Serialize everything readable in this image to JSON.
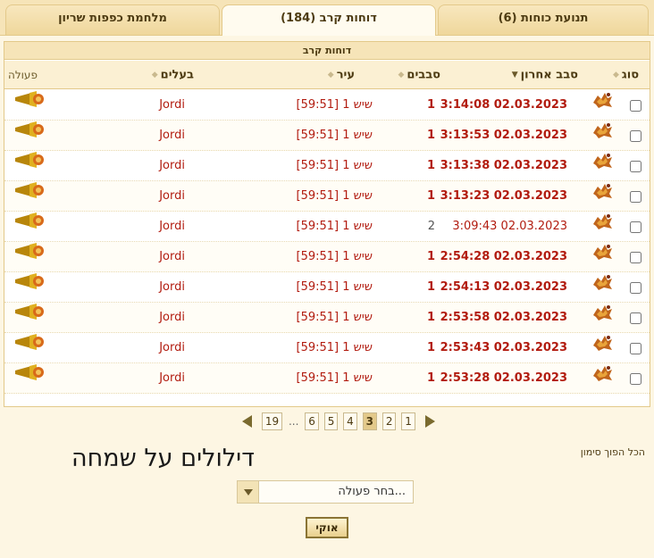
{
  "tabs": [
    {
      "label": "מלחמת כפפות שריון"
    },
    {
      "label": "דוחות קרב (184)"
    },
    {
      "label": "תנועת כוחות (6)"
    }
  ],
  "panel": {
    "title": "דוחות קרב"
  },
  "columns": {
    "type": "סוג",
    "last_round": "סבב אחרון",
    "rounds": "סבבים",
    "city": "עיר",
    "owner": "בעלים",
    "action": "פעולה"
  },
  "rows": [
    {
      "date": "3:14:08 02.03.2023",
      "rounds": "1",
      "city": "שיש 1 [59:51]",
      "owner": "Jordi",
      "unread": true
    },
    {
      "date": "3:13:53 02.03.2023",
      "rounds": "1",
      "city": "שיש 1 [59:51]",
      "owner": "Jordi",
      "unread": true
    },
    {
      "date": "3:13:38 02.03.2023",
      "rounds": "1",
      "city": "שיש 1 [59:51]",
      "owner": "Jordi",
      "unread": true
    },
    {
      "date": "3:13:23 02.03.2023",
      "rounds": "1",
      "city": "שיש 1 [59:51]",
      "owner": "Jordi",
      "unread": true
    },
    {
      "date": "3:09:43 02.03.2023",
      "rounds": "2",
      "city": "שיש 1 [59:51]",
      "owner": "Jordi",
      "unread": false
    },
    {
      "date": "2:54:28 02.03.2023",
      "rounds": "1",
      "city": "שיש 1 [59:51]",
      "owner": "Jordi",
      "unread": true
    },
    {
      "date": "2:54:13 02.03.2023",
      "rounds": "1",
      "city": "שיש 1 [59:51]",
      "owner": "Jordi",
      "unread": true
    },
    {
      "date": "2:53:58 02.03.2023",
      "rounds": "1",
      "city": "שיש 1 [59:51]",
      "owner": "Jordi",
      "unread": true
    },
    {
      "date": "2:53:43 02.03.2023",
      "rounds": "1",
      "city": "שיש 1 [59:51]",
      "owner": "Jordi",
      "unread": true
    },
    {
      "date": "2:53:28 02.03.2023",
      "rounds": "1",
      "city": "שיש 1 [59:51]",
      "owner": "Jordi",
      "unread": true
    }
  ],
  "pagination": {
    "pages_left": [
      "19",
      "...",
      "6",
      "5",
      "4"
    ],
    "current": "3",
    "pages_right": [
      "2",
      "1"
    ]
  },
  "select_all": "הכל הפוך סימון",
  "handwritten_note": "דילולים על שמחה",
  "action_select": {
    "placeholder": "בחר פעולה..."
  },
  "ok_button": "אוקי",
  "colors": {
    "accent": "#b21c10",
    "header_bg": "#f6e4b8",
    "border": "#e3c98a"
  },
  "icons": {
    "type": "battle-icon",
    "action": "horn-icon"
  }
}
